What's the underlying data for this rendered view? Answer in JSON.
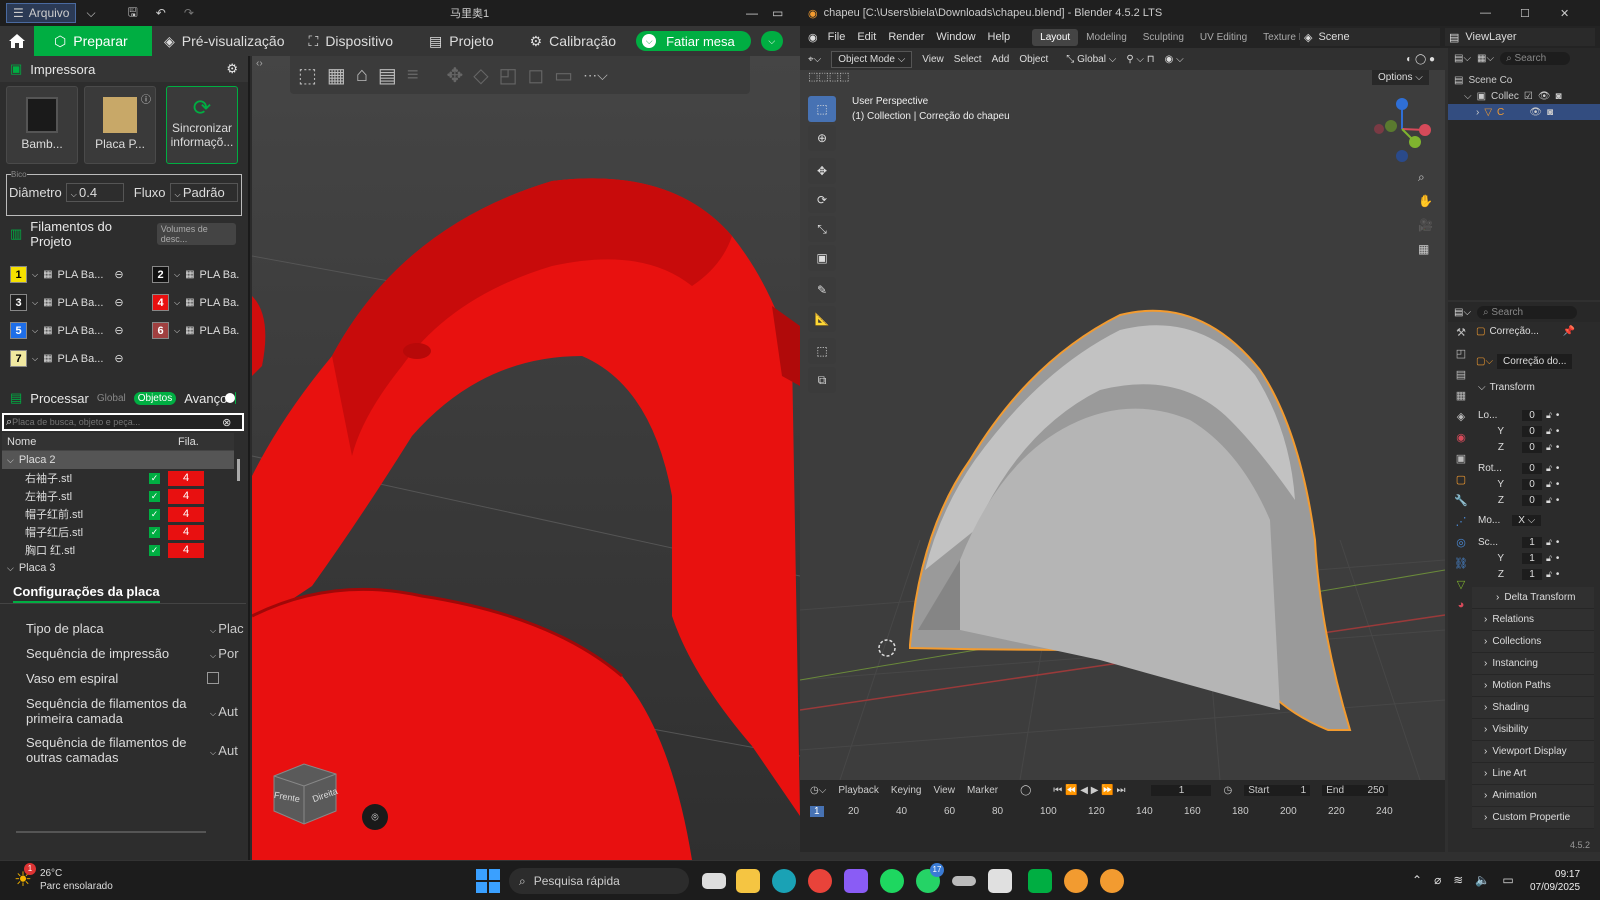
{
  "bambu": {
    "menu_file": "Arquivo",
    "title": "马里奥1",
    "tabs": [
      "Preparar",
      "Pré-visualização",
      "Dispositivo",
      "Projeto",
      "Calibração"
    ],
    "slice_label": "Fatiar mesa",
    "printer_section": "Impressora",
    "printer_card": "Bamb...",
    "plate_card": "Placa P...",
    "sync_card": "Sincronizar informaçõ...",
    "nozzle_label": "Bico",
    "diameter_label": "Diâmetro",
    "diameter_value": "0.4",
    "flow_label": "Fluxo",
    "flow_value": "Padrão",
    "filament_section": "Filamentos do Projeto",
    "filament_badge": "Volumes de desc...",
    "filaments": [
      {
        "num": "1",
        "name": "PLA Ba...",
        "color": "#f5e000",
        "text": "#000"
      },
      {
        "num": "2",
        "name": "PLA Ba.",
        "color": "#111111",
        "text": "#fff"
      },
      {
        "num": "3",
        "name": "PLA Ba...",
        "color": "#202020",
        "text": "#fff"
      },
      {
        "num": "4",
        "name": "PLA Ba.",
        "color": "#e81010",
        "text": "#fff"
      },
      {
        "num": "5",
        "name": "PLA Ba...",
        "color": "#1e6ee8",
        "text": "#fff"
      },
      {
        "num": "6",
        "name": "PLA Ba.",
        "color": "#a04040",
        "text": "#fff"
      },
      {
        "num": "7",
        "name": "PLA Ba...",
        "color": "#f0e8a0",
        "text": "#000"
      }
    ],
    "process_section": "Processar",
    "process_global": "Global",
    "process_objects": "Objetos",
    "process_advanced": "Avanço",
    "search_placeholder": "Placa de busca, objeto e peça...",
    "col_name": "Nome",
    "col_fil": "Fila.",
    "plate2": "Placa 2",
    "objects": [
      {
        "name": "右袖子.stl",
        "fil": "4"
      },
      {
        "name": "左袖子.stl",
        "fil": "4"
      },
      {
        "name": "帽子红前.stl",
        "fil": "4"
      },
      {
        "name": "帽子红后.stl",
        "fil": "4"
      },
      {
        "name": "胸口 红.stl",
        "fil": "4"
      }
    ],
    "plate3": "Placa 3",
    "plate_config_title": "Configurações da placa",
    "config": [
      {
        "label": "Tipo de placa",
        "value": "Plac"
      },
      {
        "label": "Sequência de impressão",
        "value": "Por"
      },
      {
        "label": "Vaso em espiral",
        "value": ""
      },
      {
        "label": "Sequência de filamentos da primeira camada",
        "value": "Aut"
      },
      {
        "label": "Sequência de filamentos de outras camadas",
        "value": "Aut"
      }
    ],
    "cube_front": "Frente",
    "cube_right": "Direita"
  },
  "blender": {
    "title": "chapeu [C:\\Users\\biela\\Downloads\\chapeu.blend] - Blender 4.5.2 LTS",
    "menu": [
      "File",
      "Edit",
      "Render",
      "Window",
      "Help"
    ],
    "workspaces": [
      "Layout",
      "Modeling",
      "Sculpting",
      "UV Editing",
      "Texture Pain"
    ],
    "scene": "Scene",
    "viewlayer": "ViewLayer",
    "mode": "Object Mode",
    "header_menu": [
      "View",
      "Select",
      "Add",
      "Object"
    ],
    "transform_orient": "Global",
    "options": "Options",
    "viewport_title": "User Perspective",
    "viewport_subtitle": "(1) Collection | Correção do chapeu",
    "timeline_menu": [
      "Playback",
      "Keying",
      "View",
      "Marker"
    ],
    "current_frame": "1",
    "start_label": "Start",
    "start": "1",
    "end_label": "End",
    "end": "250",
    "ruler": [
      "20",
      "40",
      "60",
      "80",
      "100",
      "120",
      "140",
      "160",
      "180",
      "200",
      "220",
      "240"
    ],
    "playhead": "1",
    "outliner_search": "Search",
    "outliner_scene": "Scene Co",
    "outliner_collection": "Collec",
    "outliner_object": "C",
    "props_search": "Search",
    "props_object": "Correção...",
    "props_object_name": "Correção do...",
    "transform": "Transform",
    "loc_label": "Lo...",
    "rot_label": "Rot...",
    "mode_label": "Mo...",
    "mode_value": "X",
    "scale_label": "Sc...",
    "loc": [
      "0",
      "0",
      "0"
    ],
    "rot": [
      "0",
      "0",
      "0"
    ],
    "scale": [
      "1",
      "1",
      "1"
    ],
    "axes": [
      "Y",
      "Z"
    ],
    "panels": [
      "Delta Transform",
      "Relations",
      "Collections",
      "Instancing",
      "Motion Paths",
      "Shading",
      "Visibility",
      "Viewport Display",
      "Line Art",
      "Animation",
      "Custom Propertie"
    ],
    "version": "4.5.2"
  },
  "taskbar": {
    "weather_temp": "26°C",
    "weather_desc": "Parc ensolarado",
    "weather_badge": "1",
    "search": "Pesquisa rápida",
    "whatsapp_badge": "17",
    "time": "09:17",
    "date": "07/09/2025"
  },
  "colors": {
    "bambu_green": "#00ae42",
    "model_red": "#e81010",
    "blender_orange": "#f29b30"
  }
}
